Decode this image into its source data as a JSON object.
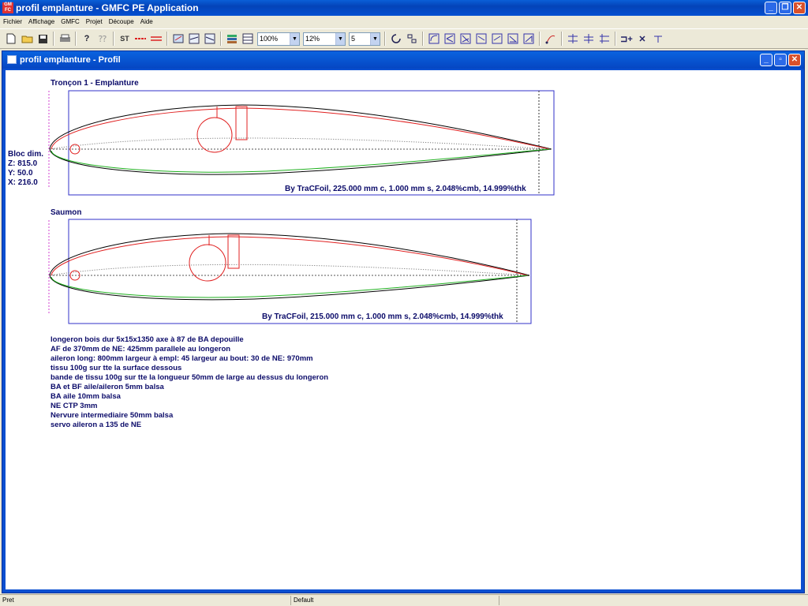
{
  "app": {
    "title": "profil emplanture - GMFC PE Application",
    "logo_text": "GM FC"
  },
  "menu": [
    {
      "id": "fichier",
      "label": "Fichier"
    },
    {
      "id": "affichage",
      "label": "Affichage"
    },
    {
      "id": "gmfc",
      "label": "GMFC"
    },
    {
      "id": "projet",
      "label": "Projet"
    },
    {
      "id": "decoupe",
      "label": "Découpe"
    },
    {
      "id": "aide",
      "label": "Aide"
    }
  ],
  "toolbar": {
    "zoom_value": "100%",
    "thickness_value": "12%",
    "count_value": "5"
  },
  "child_window": {
    "title": "profil emplanture - Profil"
  },
  "profiles": [
    {
      "heading": "Tronçon 1 - Emplanture",
      "caption": "By TraCFoil, 225.000 mm c, 1.000 mm s, 2.048%cmb, 14.999%thk"
    },
    {
      "heading": "Saumon",
      "caption": "By TraCFoil, 215.000 mm c, 1.000 mm s, 2.048%cmb, 14.999%thk"
    }
  ],
  "bloc": {
    "title": "Bloc dim.",
    "z": "Z: 815.0",
    "y": "Y: 50.0",
    "x": "X: 216.0"
  },
  "notes": [
    "longeron bois dur 5x15x1350 axe à 87 de BA depouille",
    "AF de 370mm de NE: 425mm  parallele au longeron",
    "aileron  long: 800mm  largeur à empl: 45  largeur au bout: 30  de NE: 970mm",
    "tissu 100g sur tte la surface dessous",
    "bande de tissu 100g sur tte la longueur 50mm de large au dessus du longeron",
    "BA et BF aile/aileron 5mm balsa",
    "BA aile 10mm balsa",
    "NE CTP 3mm",
    "Nervure intermediaire 50mm balsa",
    "servo aileron a 135 de NE"
  ],
  "status": {
    "left": "Pret",
    "middle": "Default"
  },
  "colors": {
    "box": "#3030c8",
    "upper_curve": "#e02020",
    "lower_curve": "#20b020",
    "outline": "#000000",
    "text": "#0c0c6a"
  },
  "icons": [
    "new-file-icon",
    "open-folder-icon",
    "save-icon",
    "print-icon",
    "help-icon",
    "whats-this-icon",
    "text-tool-icon",
    "line-red-icon",
    "line-double-icon",
    "profile-edit-icon"
  ]
}
